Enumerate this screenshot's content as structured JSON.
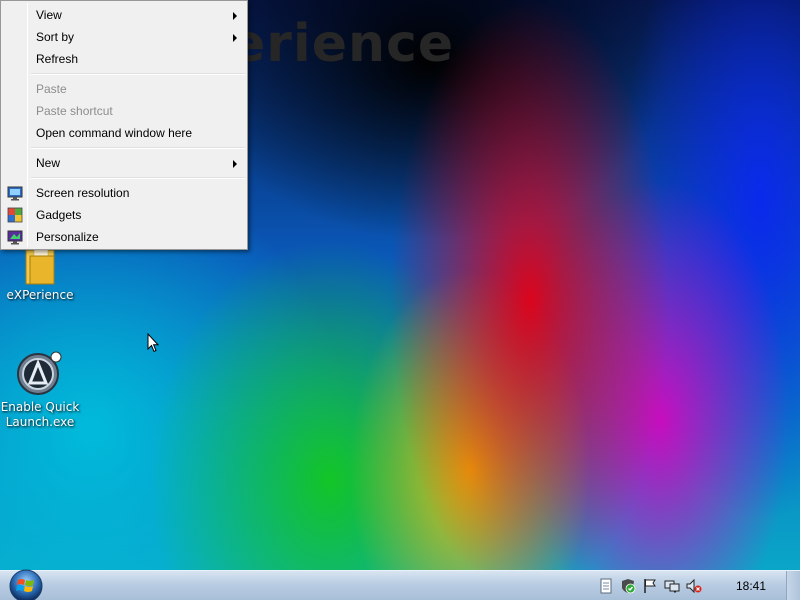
{
  "desktop": {
    "watermark": "erience",
    "icons": [
      {
        "label": "eXPerience"
      },
      {
        "label": "Enable Quick Launch.exe"
      }
    ]
  },
  "context_menu": {
    "items": [
      {
        "label": "View",
        "has_submenu": true,
        "enabled": true
      },
      {
        "label": "Sort by",
        "has_submenu": true,
        "enabled": true
      },
      {
        "label": "Refresh",
        "enabled": true
      },
      {
        "label": "Paste",
        "enabled": false
      },
      {
        "label": "Paste shortcut",
        "enabled": false
      },
      {
        "label": "Open command window here",
        "enabled": true
      },
      {
        "label": "New",
        "has_submenu": true,
        "enabled": true
      },
      {
        "label": "Screen resolution",
        "icon": "monitor-icon",
        "enabled": true
      },
      {
        "label": "Gadgets",
        "icon": "gadgets-icon",
        "enabled": true
      },
      {
        "label": "Personalize",
        "icon": "personalize-icon",
        "enabled": true
      }
    ]
  },
  "taskbar": {
    "start_icon": "windows-orb-icon",
    "tray_icons": [
      "document-icon",
      "security-shield-icon",
      "action-center-flag-icon",
      "network-icon",
      "volume-muted-icon"
    ],
    "clock": "18:41"
  },
  "colors": {
    "menu_bg": "#f0f0f0",
    "disabled_text": "#8d8d8d",
    "taskbar_top": "#d8e4f1"
  }
}
